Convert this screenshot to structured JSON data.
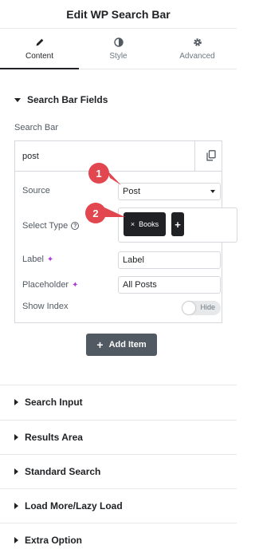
{
  "header": {
    "title": "Edit WP Search Bar"
  },
  "tabs": [
    {
      "label": "Content",
      "icon": "pencil-icon",
      "active": true
    },
    {
      "label": "Style",
      "icon": "contrast-icon",
      "active": false
    },
    {
      "label": "Advanced",
      "icon": "gear-icon",
      "active": false
    }
  ],
  "section": {
    "title": "Search Bar Fields"
  },
  "search_bar_label": "Search Bar",
  "repeater": {
    "item_title": "post",
    "fields": {
      "source_label": "Source",
      "source_value": "Post",
      "select_type_label": "Select Type",
      "select_type_chip": "Books",
      "label_label": "Label",
      "label_value": "Label",
      "placeholder_label": "Placeholder",
      "placeholder_value": "All Posts",
      "show_index_label": "Show Index",
      "show_index_toggle": "Hide"
    }
  },
  "badges": [
    "1",
    "2"
  ],
  "add_item_label": "Add Item",
  "collapsed_sections": [
    "Search Input",
    "Results Area",
    "Standard Search",
    "Load More/Lazy Load",
    "Extra Option"
  ],
  "colors": {
    "accent_dark": "#1f2124",
    "badge_red": "#e2464f",
    "button_gray": "#515962",
    "sparkle_purple": "#b03bd8"
  }
}
